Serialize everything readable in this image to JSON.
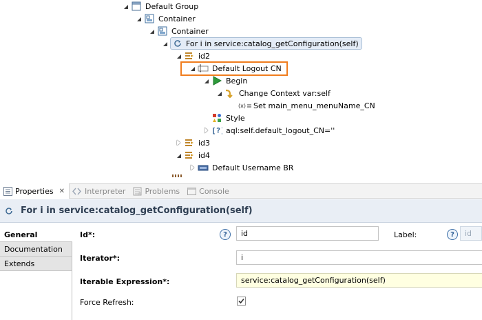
{
  "tree": {
    "nodes": [
      {
        "label": "Default Group",
        "icon": "group-icon"
      },
      {
        "label": "Container",
        "icon": "container-icon"
      },
      {
        "label": "Container",
        "icon": "container-icon"
      },
      {
        "label": "For i in service:catalog_getConfiguration(self)",
        "icon": "for-loop-icon"
      },
      {
        "label": "id2",
        "icon": "container-id-icon"
      },
      {
        "label": "Default Logout CN",
        "icon": "button-widget-icon"
      },
      {
        "label": "Begin",
        "icon": "begin-play-icon"
      },
      {
        "label": "Change Context var:self",
        "icon": "change-context-icon"
      },
      {
        "label": "Set main_menu_menuName_CN",
        "icon": "set-variable-icon"
      },
      {
        "label": "Style",
        "icon": "style-icon"
      },
      {
        "label": "aql:self.default_logout_CN=''",
        "icon": "conditional-icon"
      },
      {
        "label": "id3",
        "icon": "container-id-icon"
      },
      {
        "label": "id4",
        "icon": "container-id-icon"
      },
      {
        "label": "Default Username BR",
        "icon": "text-widget-icon"
      }
    ]
  },
  "views": {
    "tabs": [
      {
        "label": "Properties",
        "icon": "properties-icon"
      },
      {
        "label": "Interpreter",
        "icon": "interpreter-icon"
      },
      {
        "label": "Problems",
        "icon": "problems-icon"
      },
      {
        "label": "Console",
        "icon": "console-icon"
      }
    ],
    "close_glyph": "✕"
  },
  "properties": {
    "title": "For i in service:catalog_getConfiguration(self)",
    "sections": [
      "General",
      "Documentation",
      "Extends"
    ],
    "fields": {
      "id_label": "Id*:",
      "id_value": "id",
      "label_label": "Label:",
      "label_value": "id",
      "iterator_label": "Iterator*:",
      "iterator_value": "i",
      "iterable_label": "Iterable Expression*:",
      "iterable_value": "service:catalog_getConfiguration(self)",
      "force_refresh_label": "Force Refresh:",
      "force_refresh_checked": true,
      "help_glyph": "?"
    }
  },
  "colors": {
    "highlight": "#f07d1e",
    "title_bar": "#e9eef5",
    "expression_bg": "#ffffe1"
  }
}
